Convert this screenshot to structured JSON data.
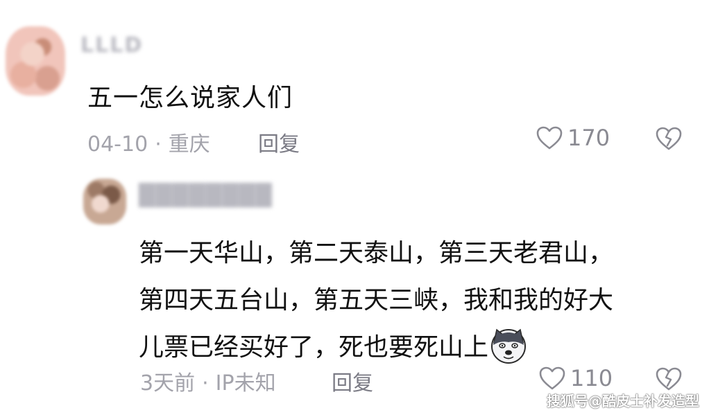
{
  "comments": [
    {
      "username": "LLLD",
      "text": "五一怎么说家人们",
      "date": "04-10",
      "location": "重庆",
      "reply_label": "回复",
      "likes": "170"
    },
    {
      "username": "████████",
      "lines": [
        "第一天华山，第二天泰山，第三天老君山，",
        "第四天五台山，第五天三峡，我和我的好大",
        "儿票已经买好了，死也要死山上"
      ],
      "date": "3天前",
      "location": "IP未知",
      "reply_label": "回复",
      "likes": "110"
    }
  ],
  "separator": "·",
  "watermark": "搜狐号@酷皮士补发造型",
  "colors": {
    "text": "#111111",
    "meta": "#a3a3ab",
    "icon": "#8a8a92"
  },
  "icons": {
    "like": "heart-outline-icon",
    "dislike": "broken-heart-icon",
    "emoji": "doge-emoji-icon"
  }
}
